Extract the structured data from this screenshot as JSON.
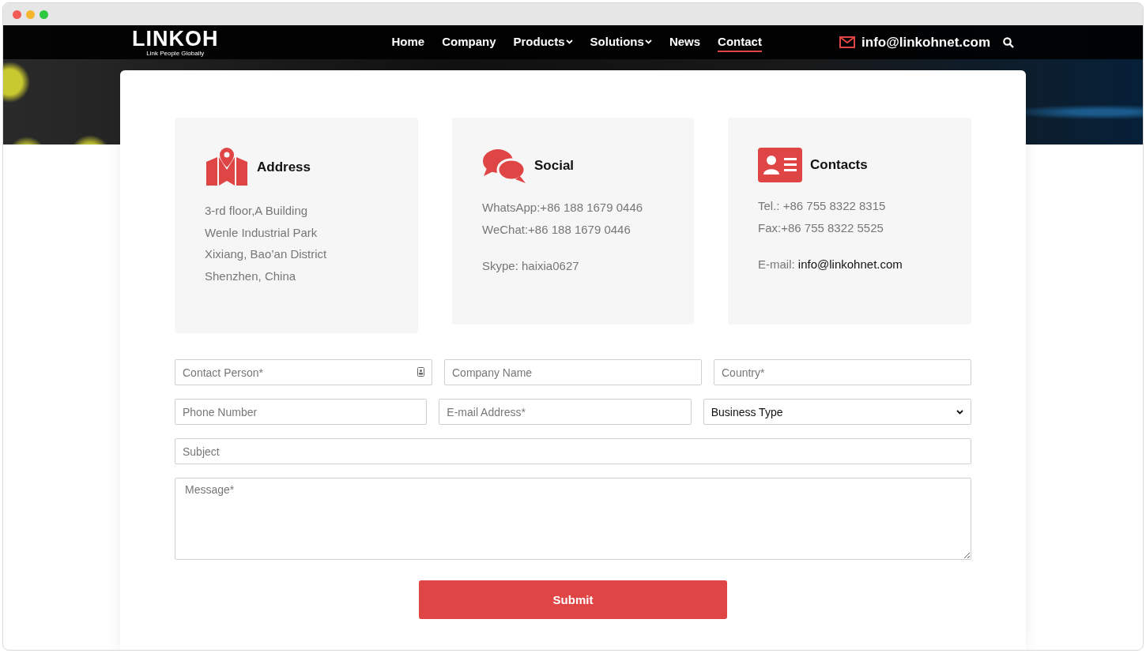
{
  "header": {
    "logo": {
      "name": "LINKOH",
      "tagline": "Link People Globally"
    },
    "nav": [
      {
        "label": "Home",
        "dropdown": false,
        "selected": false
      },
      {
        "label": "Company",
        "dropdown": false,
        "selected": false
      },
      {
        "label": "Products",
        "dropdown": true,
        "selected": false
      },
      {
        "label": "Solutions",
        "dropdown": true,
        "selected": false
      },
      {
        "label": "News",
        "dropdown": false,
        "selected": false
      },
      {
        "label": "Contact",
        "dropdown": false,
        "selected": true
      }
    ],
    "email": "info@linkohnet.com"
  },
  "info_cards": [
    {
      "kind": "address",
      "title": "Address",
      "paragraphs": [
        [
          {
            "text": "3-rd floor,A Building"
          },
          {
            "text": "Wenle Industrial Park"
          },
          {
            "text": "Xixiang, Bao’an District"
          },
          {
            "text": "Shenzhen, China"
          }
        ]
      ]
    },
    {
      "kind": "social",
      "title": "Social",
      "paragraphs": [
        [
          {
            "text": "WhatsApp:+86 188 1679 0446"
          },
          {
            "text": "WeChat:+86 188 1679 0446"
          }
        ],
        [
          {
            "text": "Skype: haixia0627"
          }
        ]
      ]
    },
    {
      "kind": "contacts",
      "title": "Contacts",
      "paragraphs": [
        [
          {
            "text": "Tel.: +86 755 8322 8315"
          },
          {
            "text": "Fax:+86 755 8322 5525"
          }
        ],
        [
          {
            "text": "E-mail:",
            "link": "info@linkohnet.com"
          }
        ]
      ]
    }
  ],
  "form": {
    "rows": [
      [
        {
          "kind": "text",
          "placeholder": "Contact Person*",
          "contact_icon": true
        },
        {
          "kind": "text",
          "placeholder": "Company Name"
        },
        {
          "kind": "text",
          "placeholder": "Country*"
        }
      ],
      [
        {
          "kind": "text",
          "placeholder": "Phone Number"
        },
        {
          "kind": "text",
          "placeholder": "E-mail Address*"
        },
        {
          "kind": "select",
          "value": "Business Type"
        }
      ],
      [
        {
          "kind": "text",
          "placeholder": "Subject"
        }
      ],
      [
        {
          "kind": "textarea",
          "placeholder": "Message*"
        }
      ]
    ],
    "submit": "Submit"
  }
}
